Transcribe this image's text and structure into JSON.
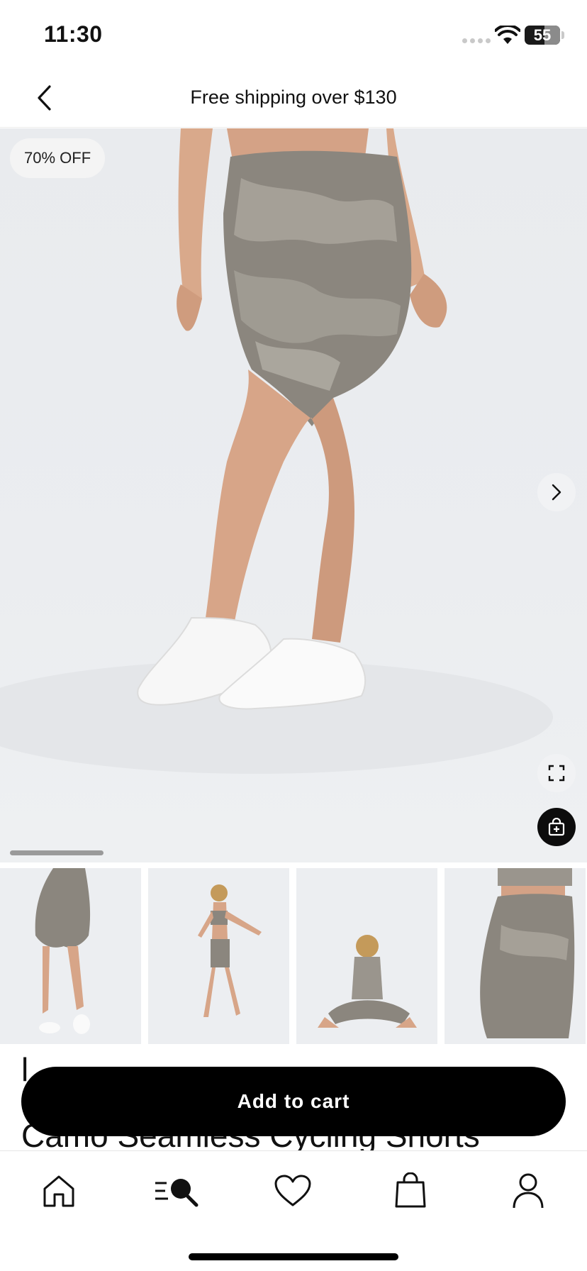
{
  "status_bar": {
    "time": "11:30",
    "battery": "55"
  },
  "header": {
    "title": "Free shipping over $130"
  },
  "product": {
    "discount_badge": "70% OFF",
    "title_line1": "l",
    "title_line2": "Camo Seamless Cycling Shorts",
    "add_to_cart_label": "Add to cart",
    "thumbnail_count": 4
  },
  "tabbar": {
    "items": [
      {
        "icon": "home-icon"
      },
      {
        "icon": "search-icon"
      },
      {
        "icon": "heart-icon"
      },
      {
        "icon": "bag-icon"
      },
      {
        "icon": "account-icon"
      }
    ]
  },
  "colors": {
    "accent": "#000000",
    "background": "#ffffff",
    "hero_bg": "#eaecef"
  }
}
